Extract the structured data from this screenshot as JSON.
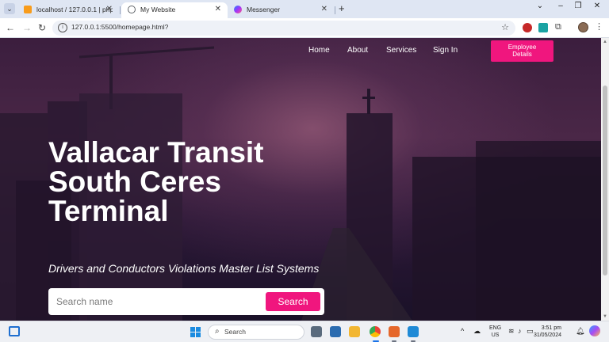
{
  "browser": {
    "tabs": [
      {
        "title": "localhost / 127.0.0.1 | phpMyAd",
        "favicon_color": "#f89c1c",
        "active": false
      },
      {
        "title": "My Website",
        "favicon_color": "#5f6368",
        "active": true
      },
      {
        "title": "Messenger",
        "favicon_color": "#a334fa",
        "active": false
      }
    ],
    "tab_close_symbol": "✕",
    "new_tab_symbol": "+",
    "url": "127.0.0.1:5500/homepage.html?",
    "window_controls": [
      "⌄",
      "–",
      "❐",
      "✕"
    ]
  },
  "nav": {
    "links": [
      "Home",
      "About",
      "Services",
      "Sign In"
    ],
    "employee_button": [
      "Employee",
      "Details"
    ]
  },
  "hero": {
    "title_lines": [
      "Vallacar Transit",
      "South Ceres",
      "Terminal"
    ],
    "subtitle": "Drivers and Conductors Violations Master List Systems",
    "search_placeholder": "Search name",
    "search_button": "Search"
  },
  "colors": {
    "accent": "#f0167e",
    "tab_strip": "#dfe6f3"
  },
  "taskbar": {
    "search_label": "Search",
    "language": [
      "ENG",
      "US"
    ],
    "time": "3:51 pm",
    "date": "31/05/2024"
  }
}
